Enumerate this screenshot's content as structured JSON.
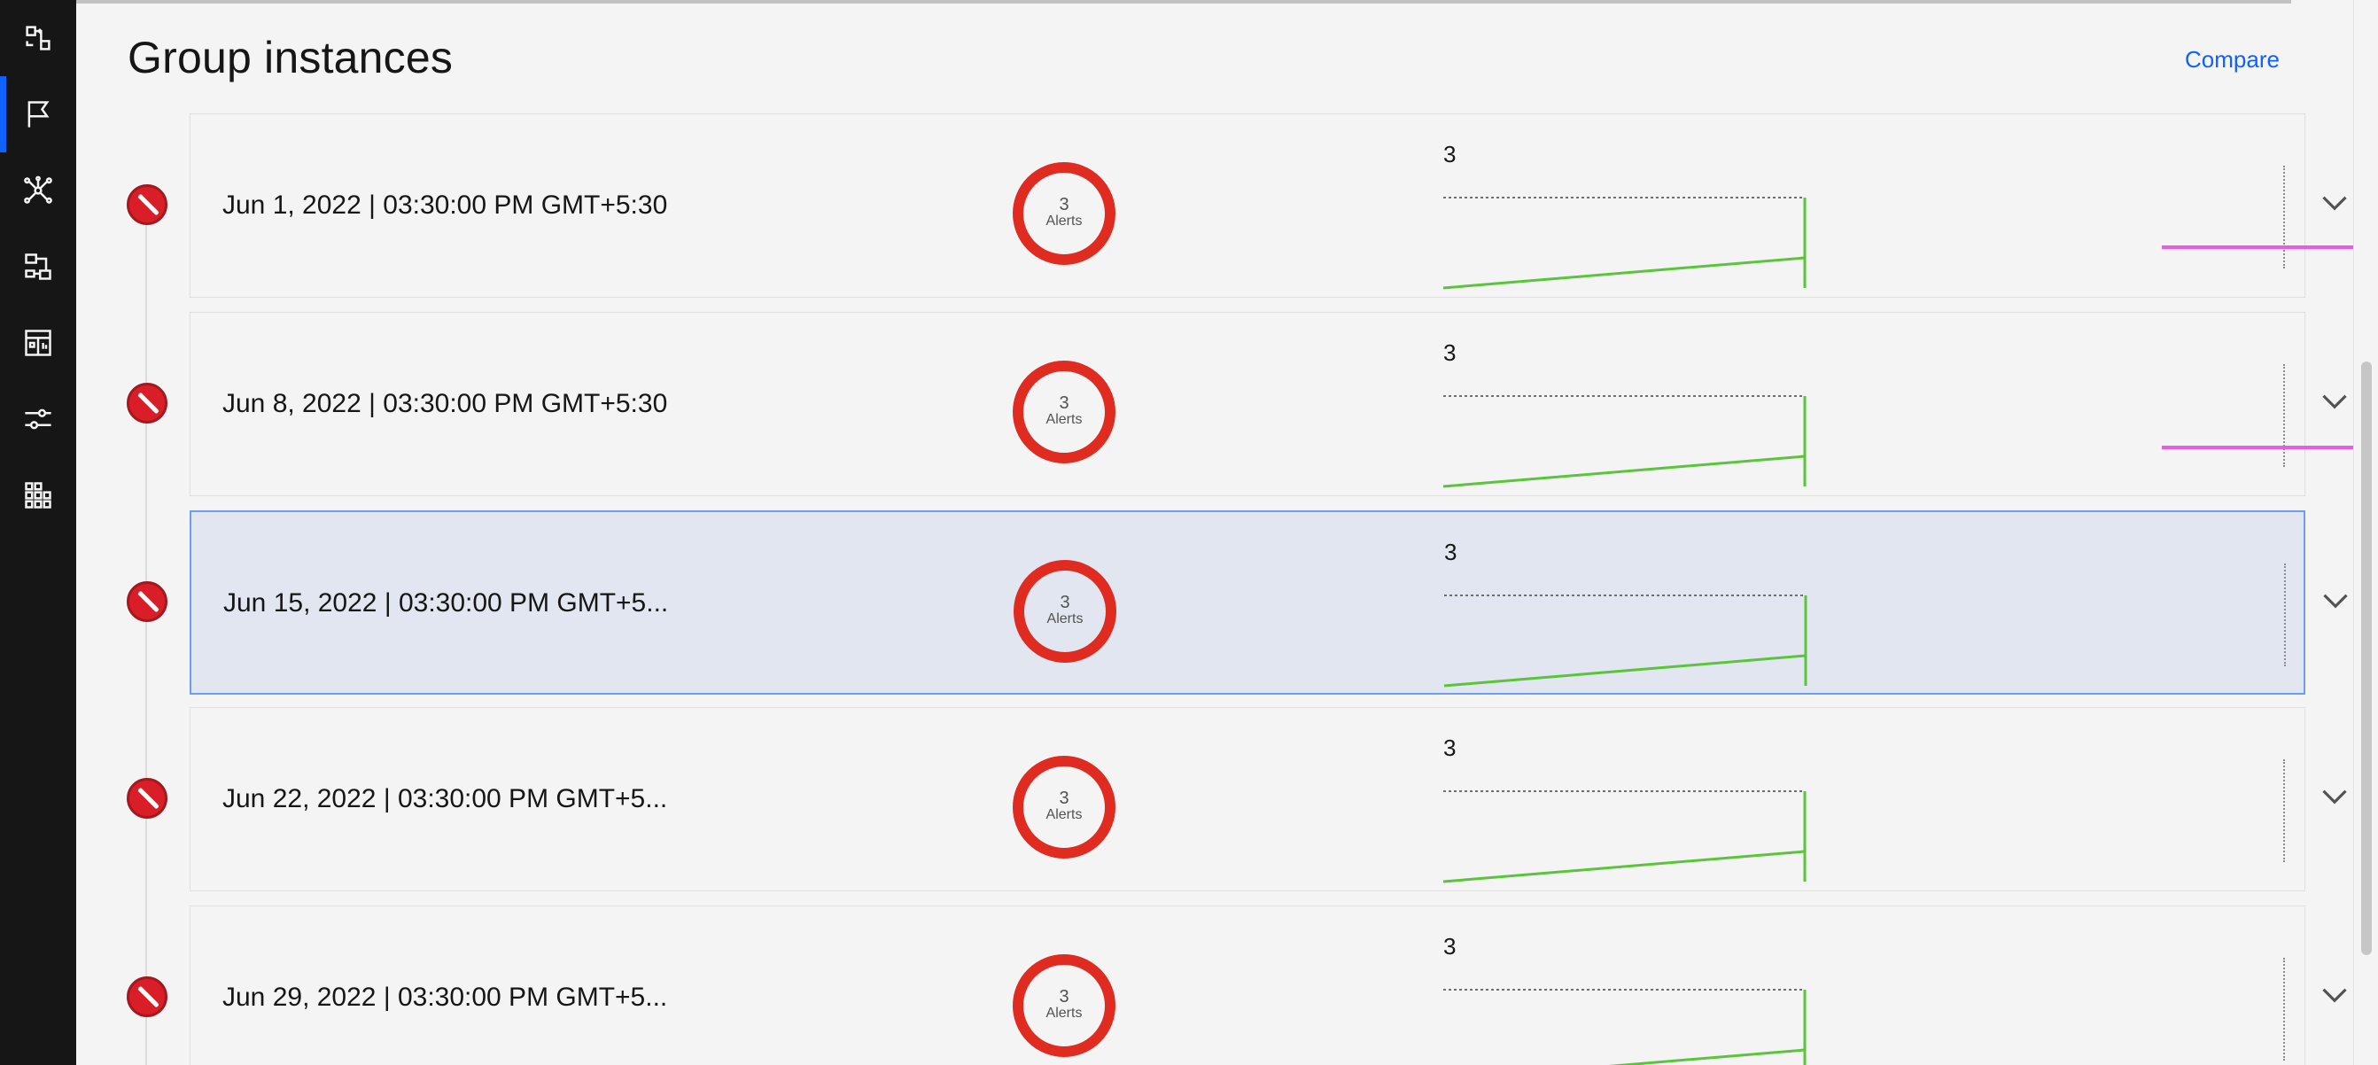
{
  "page": {
    "title": "Group instances",
    "compare_label": "Compare"
  },
  "nav": {
    "items": [
      {
        "icon": "flow-icon",
        "active": false
      },
      {
        "icon": "flag-icon",
        "active": true
      },
      {
        "icon": "network-icon",
        "active": false
      },
      {
        "icon": "workflow-icon",
        "active": false
      },
      {
        "icon": "dashboard-table-icon",
        "active": false
      },
      {
        "icon": "settings-sliders-icon",
        "active": false
      },
      {
        "icon": "heat-map-icon",
        "active": false
      }
    ]
  },
  "instances": [
    {
      "date": "Jun 1, 2022 | 03:30:00 PM GMT+5:30",
      "alerts_count": "3",
      "alerts_label": "Alerts",
      "spark_max": "3",
      "selected": false
    },
    {
      "date": "Jun 8, 2022 | 03:30:00 PM GMT+5:30",
      "alerts_count": "3",
      "alerts_label": "Alerts",
      "spark_max": "3",
      "selected": false
    },
    {
      "date": "Jun 15, 2022 | 03:30:00 PM GMT+5...",
      "alerts_count": "3",
      "alerts_label": "Alerts",
      "spark_max": "3",
      "selected": true
    },
    {
      "date": "Jun 22, 2022 | 03:30:00 PM GMT+5...",
      "alerts_count": "3",
      "alerts_label": "Alerts",
      "spark_max": "3",
      "selected": false
    },
    {
      "date": "Jun 29, 2022 | 03:30:00 PM GMT+5...",
      "alerts_count": "3",
      "alerts_label": "Alerts",
      "spark_max": "3",
      "selected": false
    }
  ],
  "colors": {
    "alert_ring": "#e02b20",
    "status_error": "#da1e28",
    "spark_line": "#5ac53b",
    "accent": "#0f62fe",
    "selected_row": "#e2e6f1",
    "annotation": "#e85ce5"
  }
}
